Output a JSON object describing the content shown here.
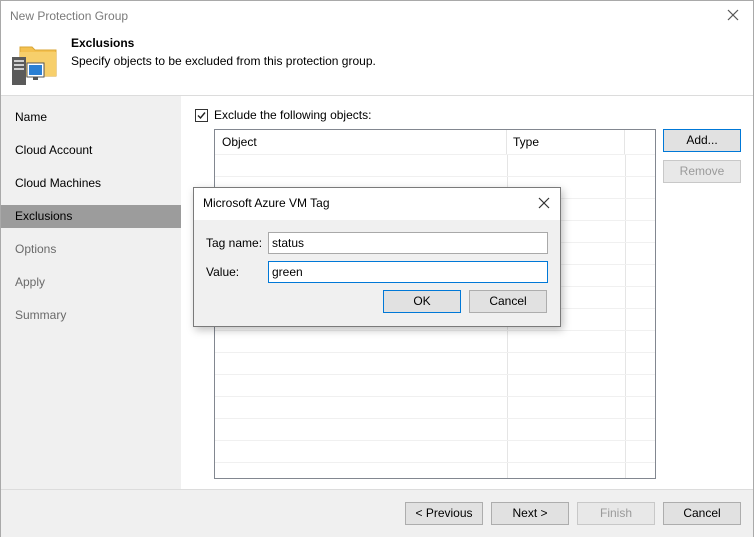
{
  "window": {
    "title": "New Protection Group"
  },
  "header": {
    "title": "Exclusions",
    "subtitle": "Specify objects to be excluded from this protection group.",
    "icon": "folder-server-icon"
  },
  "sidebar": {
    "items": [
      {
        "label": "Name",
        "state": "normal"
      },
      {
        "label": "Cloud Account",
        "state": "normal"
      },
      {
        "label": "Cloud Machines",
        "state": "normal"
      },
      {
        "label": "Exclusions",
        "state": "active"
      },
      {
        "label": "Options",
        "state": "dim"
      },
      {
        "label": "Apply",
        "state": "dim"
      },
      {
        "label": "Summary",
        "state": "dim"
      }
    ]
  },
  "exclusions": {
    "checkbox_label": "Exclude the following objects:",
    "checked": true,
    "columns": {
      "object": "Object",
      "type": "Type"
    },
    "add_label": "Add...",
    "remove_label": "Remove"
  },
  "dialog": {
    "title": "Microsoft Azure VM Tag",
    "tag_name_label": "Tag name:",
    "tag_name_value": "status",
    "value_label": "Value:",
    "value_value": "green",
    "ok_label": "OK",
    "cancel_label": "Cancel"
  },
  "footer": {
    "previous_label": "< Previous",
    "next_label": "Next >",
    "finish_label": "Finish",
    "cancel_label": "Cancel"
  },
  "colors": {
    "accent": "#0078d7",
    "sidebar_bg": "#f0f0f0",
    "active_nav": "#9c9c9c",
    "folder": "#f4c150"
  }
}
